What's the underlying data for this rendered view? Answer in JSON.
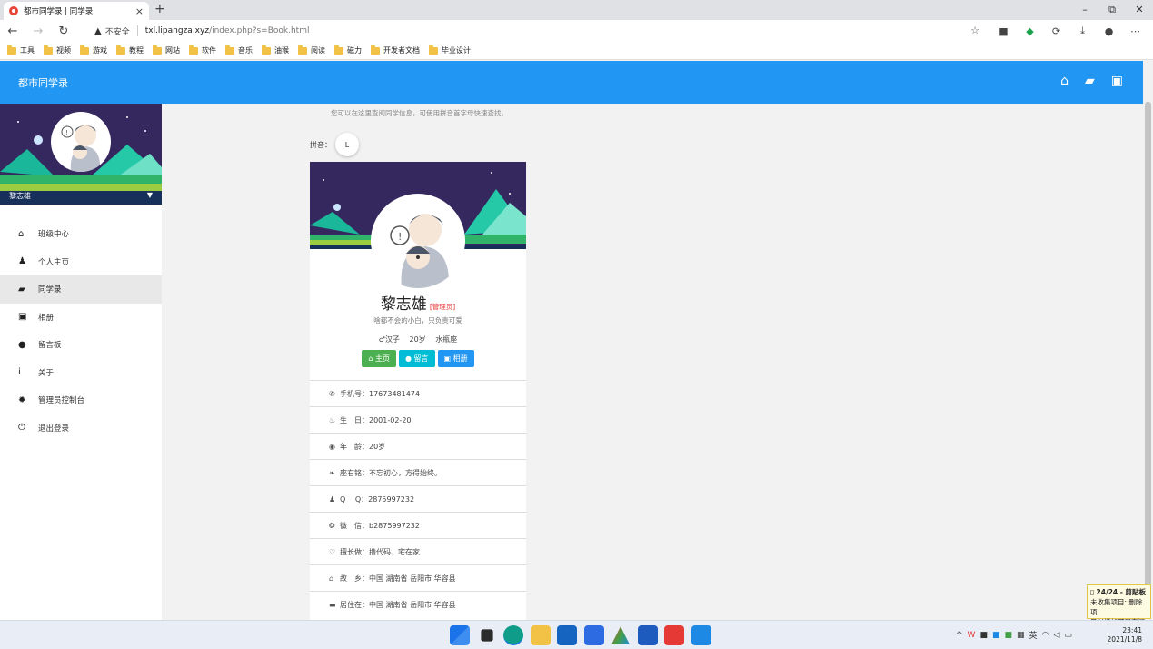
{
  "browser": {
    "tab_title": "都市同学录 | 同学录",
    "tab_close": "×",
    "new_tab": "+",
    "win_minimize": "–",
    "win_restore": "⧉",
    "win_close": "✕",
    "security_label": "不安全",
    "url_host": "txl.lipangza.xyz",
    "url_path": "/index.php?s=Book.html",
    "bookmarks": [
      "工具",
      "视频",
      "游戏",
      "教程",
      "网站",
      "软件",
      "音乐",
      "油猴",
      "阅读",
      "磁力",
      "开发者文档",
      "毕业设计"
    ]
  },
  "app": {
    "brand": "都市同学录"
  },
  "sidebar": {
    "user_name": "黎志雄",
    "items": [
      {
        "icon": "home-icon",
        "label": "班级中心"
      },
      {
        "icon": "user-icon",
        "label": "个人主页"
      },
      {
        "icon": "book-icon",
        "label": "同学录",
        "active": true
      },
      {
        "icon": "image-icon",
        "label": "相册"
      },
      {
        "icon": "comment-icon",
        "label": "留言板"
      },
      {
        "icon": "info-icon",
        "label": "关于"
      },
      {
        "icon": "gear-icon",
        "label": "管理员控制台"
      },
      {
        "icon": "power-icon",
        "label": "退出登录"
      }
    ]
  },
  "main": {
    "hint": "您可以在这里查阅同学信息，可使用拼音首字母快速查找。",
    "pinyin_label": "拼音：",
    "pinyin_letter": "L",
    "card": {
      "name": "黎志雄",
      "role": "[管理员]",
      "motto": "啥都不会的小白，只负责可爱",
      "gender": "♂汉子",
      "age_tag": "20岁",
      "zodiac": "水瓶座",
      "buttons": {
        "home": "主页",
        "message": "留言",
        "album": "相册"
      },
      "info": [
        {
          "icon": "phone-icon",
          "glyph": "✆",
          "label": "手机号：",
          "value": "17673481474"
        },
        {
          "icon": "cake-icon",
          "glyph": "♨",
          "label": "生　日：",
          "value": "2001-02-20"
        },
        {
          "icon": "globe-icon",
          "glyph": "◉",
          "label": "年　龄：",
          "value": "20岁"
        },
        {
          "icon": "leaf-icon",
          "glyph": "❧",
          "label": "座右铭：",
          "value": "不忘初心，方得始终。"
        },
        {
          "icon": "qq-icon",
          "glyph": "♟",
          "label": "Q　 Q：",
          "value": "2875997232"
        },
        {
          "icon": "wechat-icon",
          "glyph": "❂",
          "label": "微　信：",
          "value": "b2875997232"
        },
        {
          "icon": "heart-icon",
          "glyph": "♡",
          "label": "擅长做：",
          "value": "撸代码、宅在家"
        },
        {
          "icon": "home-icon",
          "glyph": "⌂",
          "label": "故　乡：",
          "value": "中国 湖南省 岳阳市 华容县"
        },
        {
          "icon": "bed-icon",
          "glyph": "▬",
          "label": "居住在：",
          "value": "中国 湖南省 岳阳市 华容县"
        }
      ]
    }
  },
  "clipboard": {
    "count": "24/24 - 剪贴板",
    "text1": "未收集项目: 删除项",
    "text2": "目以增加可用空间"
  },
  "taskbar": {
    "ime": "英",
    "time": "23:41",
    "date": "2021/11/8"
  },
  "colors": {
    "primary": "#2196f3",
    "green": "#4caf50",
    "cyan": "#00bcd4",
    "admin_red": "#e53935"
  }
}
